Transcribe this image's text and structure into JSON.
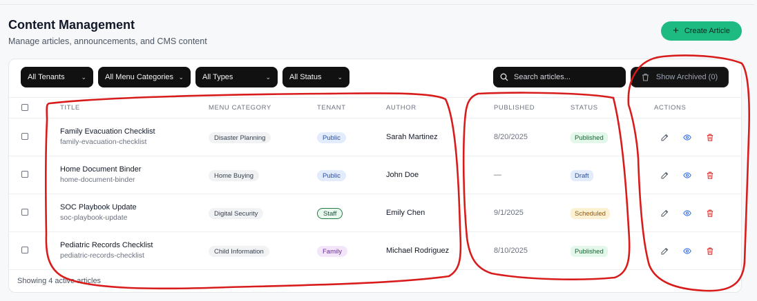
{
  "header": {
    "title": "Content Management",
    "subtitle": "Manage articles, announcements, and CMS content",
    "create_label": "Create Article"
  },
  "filters": [
    {
      "label": "All Tenants"
    },
    {
      "label": "All Menu Categories"
    },
    {
      "label": "All Types"
    },
    {
      "label": "All Status"
    }
  ],
  "search": {
    "placeholder": "Search articles..."
  },
  "archived": {
    "label": "Show Archived (0)"
  },
  "columns": {
    "title": "TITLE",
    "menu_category": "MENU CATEGORY",
    "tenant": "TENANT",
    "author": "AUTHOR",
    "published": "PUBLISHED",
    "status": "STATUS",
    "actions": "ACTIONS"
  },
  "rows": [
    {
      "title": "Family Evacuation Checklist",
      "slug": "family-evacuation-checklist",
      "category": "Disaster Planning",
      "tenant": "Public",
      "author": "Sarah Martinez",
      "published": "8/20/2025",
      "status": "Published"
    },
    {
      "title": "Home Document Binder",
      "slug": "home-document-binder",
      "category": "Home Buying",
      "tenant": "Public",
      "author": "John Doe",
      "published": "—",
      "status": "Draft"
    },
    {
      "title": "SOC Playbook Update",
      "slug": "soc-playbook-update",
      "category": "Digital Security",
      "tenant": "Staff",
      "author": "Emily Chen",
      "published": "9/1/2025",
      "status": "Scheduled"
    },
    {
      "title": "Pediatric Records Checklist",
      "slug": "pediatric-records-checklist",
      "category": "Child Information",
      "tenant": "Family",
      "author": "Michael Rodriguez",
      "published": "8/10/2025",
      "status": "Published"
    }
  ],
  "footer": {
    "text": "Showing 4 active articles"
  },
  "colors": {
    "accent": "#1dba82",
    "annotation": "#d81b1b",
    "delete": "#dc2626",
    "view": "#2563eb"
  }
}
